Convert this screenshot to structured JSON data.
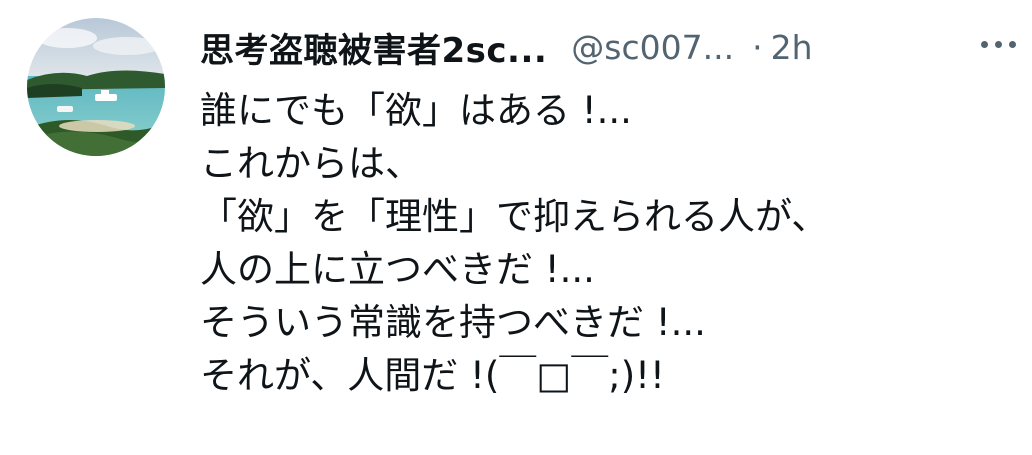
{
  "tweet": {
    "display_name": "思考盗聴被害者2sc...",
    "handle": "@sc007...",
    "separator": "·",
    "timestamp": "2h",
    "more_icon": "more-horizontal-icon",
    "lines": [
      "誰にでも「欲」はある !...",
      "これからは、",
      "「欲」を「理性」で抑えられる人が、",
      "人の上に立つべきだ !...",
      "そういう常識を持つべきだ !...",
      "それが、人間だ !(￣□￣;)!!"
    ]
  },
  "colors": {
    "text_primary": "#0f1419",
    "text_secondary": "#536471",
    "background": "#ffffff"
  }
}
